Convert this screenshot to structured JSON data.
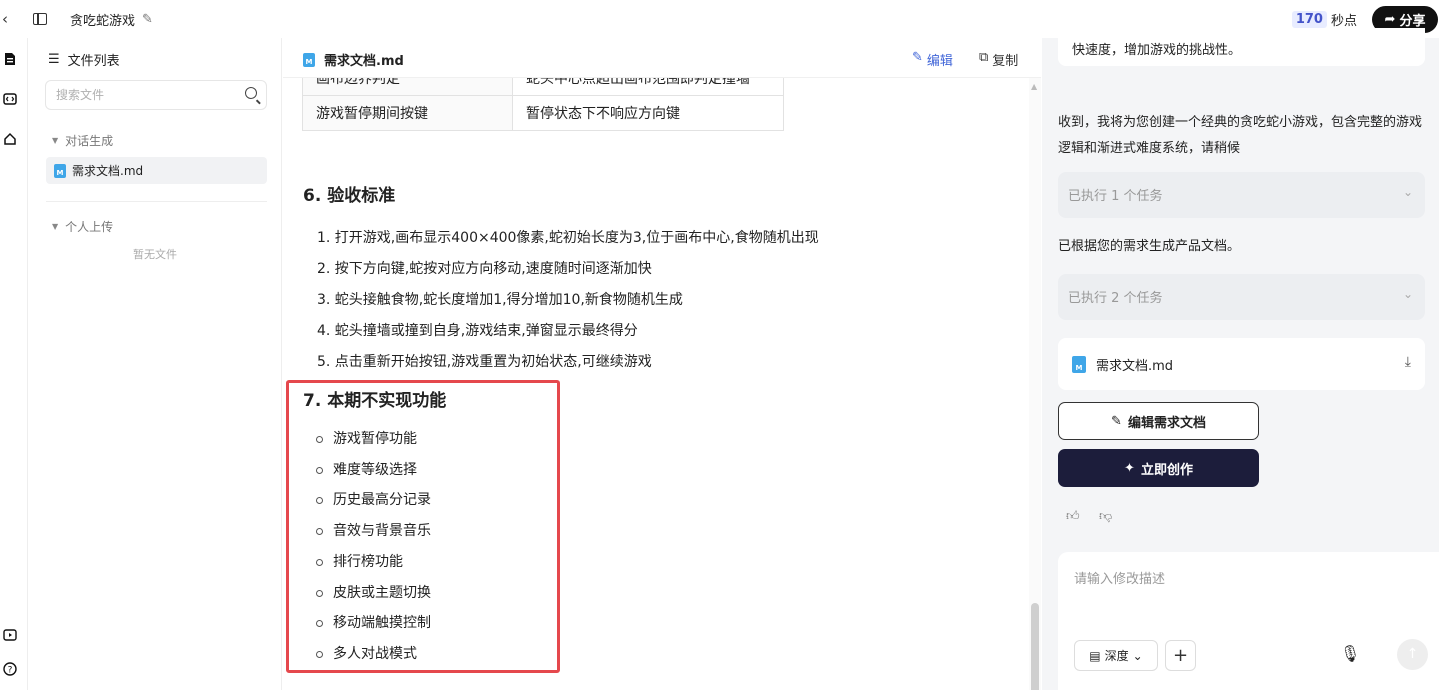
{
  "topbar": {
    "back_icon": "‹",
    "title": "贪吃蛇游戏",
    "edit_icon": "✎",
    "timer_value": "170",
    "timer_unit": "秒点",
    "share_icon": "➦",
    "share_label": "分享"
  },
  "rail": {
    "icons": [
      "doc-icon",
      "code-icon",
      "home-icon",
      "play-icon",
      "help-icon"
    ]
  },
  "files": {
    "header_icon": "☰",
    "header": "文件列表",
    "search_placeholder": "搜索文件",
    "group1": "对话生成",
    "group1_toggle": "▼",
    "file1": "需求文档.md",
    "md_badge": "M",
    "group2": "个人上传",
    "group2_toggle": "▼",
    "empty": "暂无文件"
  },
  "doc": {
    "filename": "需求文档.md",
    "edit_icon": "✎",
    "edit_label": "编辑",
    "copy_icon": "⧉",
    "copy_label": "复制",
    "table_rows": [
      [
        "画布边界判定",
        "蛇头中心点超出画布范围即判定撞墙"
      ],
      [
        "游戏暂停期间按键",
        "暂停状态下不响应方向键"
      ]
    ],
    "section6_title": "6. 验收标准",
    "acceptance": [
      "1. 打开游戏,画布显示400×400像素,蛇初始长度为3,位于画布中心,食物随机出现",
      "2. 按下方向键,蛇按对应方向移动,速度随时间逐渐加快",
      "3. 蛇头接触食物,蛇长度增加1,得分增加10,新食物随机生成",
      "4. 蛇头撞墙或撞到自身,游戏结束,弹窗显示最终得分",
      "5. 点击重新开始按钮,游戏重置为初始状态,可继续游戏"
    ],
    "section7_title": "7. 本期不实现功能",
    "not_implemented": [
      "游戏暂停功能",
      "难度等级选择",
      "历史最高分记录",
      "音效与背景音乐",
      "排行榜功能",
      "皮肤或主题切换",
      "移动端触摸控制",
      "多人对战模式"
    ],
    "scroll_up_icon": "▲"
  },
  "chat": {
    "prev_bubble": "快速度，增加游戏的挑战性。",
    "msg1": "收到，我将为您创建一个经典的贪吃蛇小游戏，包含完整的游戏逻辑和渐进式难度系统，请稍候",
    "task1": "已执行 1 个任务",
    "chevron": "⌄",
    "msg2": "已根据您的需求生成产品文档。",
    "task2": "已执行 2 个任务",
    "file_card": "需求文档.md",
    "download_icon": "⤓",
    "edit_btn_icon": "✎",
    "edit_btn": "编辑需求文档",
    "create_icon": "✦",
    "create_btn": "立即创作",
    "like_icon": "👍︎",
    "dislike_icon": "👎︎",
    "input_placeholder": "请输入修改描述",
    "depth_icon": "▤",
    "depth_label": "深度",
    "depth_caret": "⌄",
    "plus_icon": "+",
    "mic_icon": "🎙︎",
    "send_icon": "↑"
  }
}
